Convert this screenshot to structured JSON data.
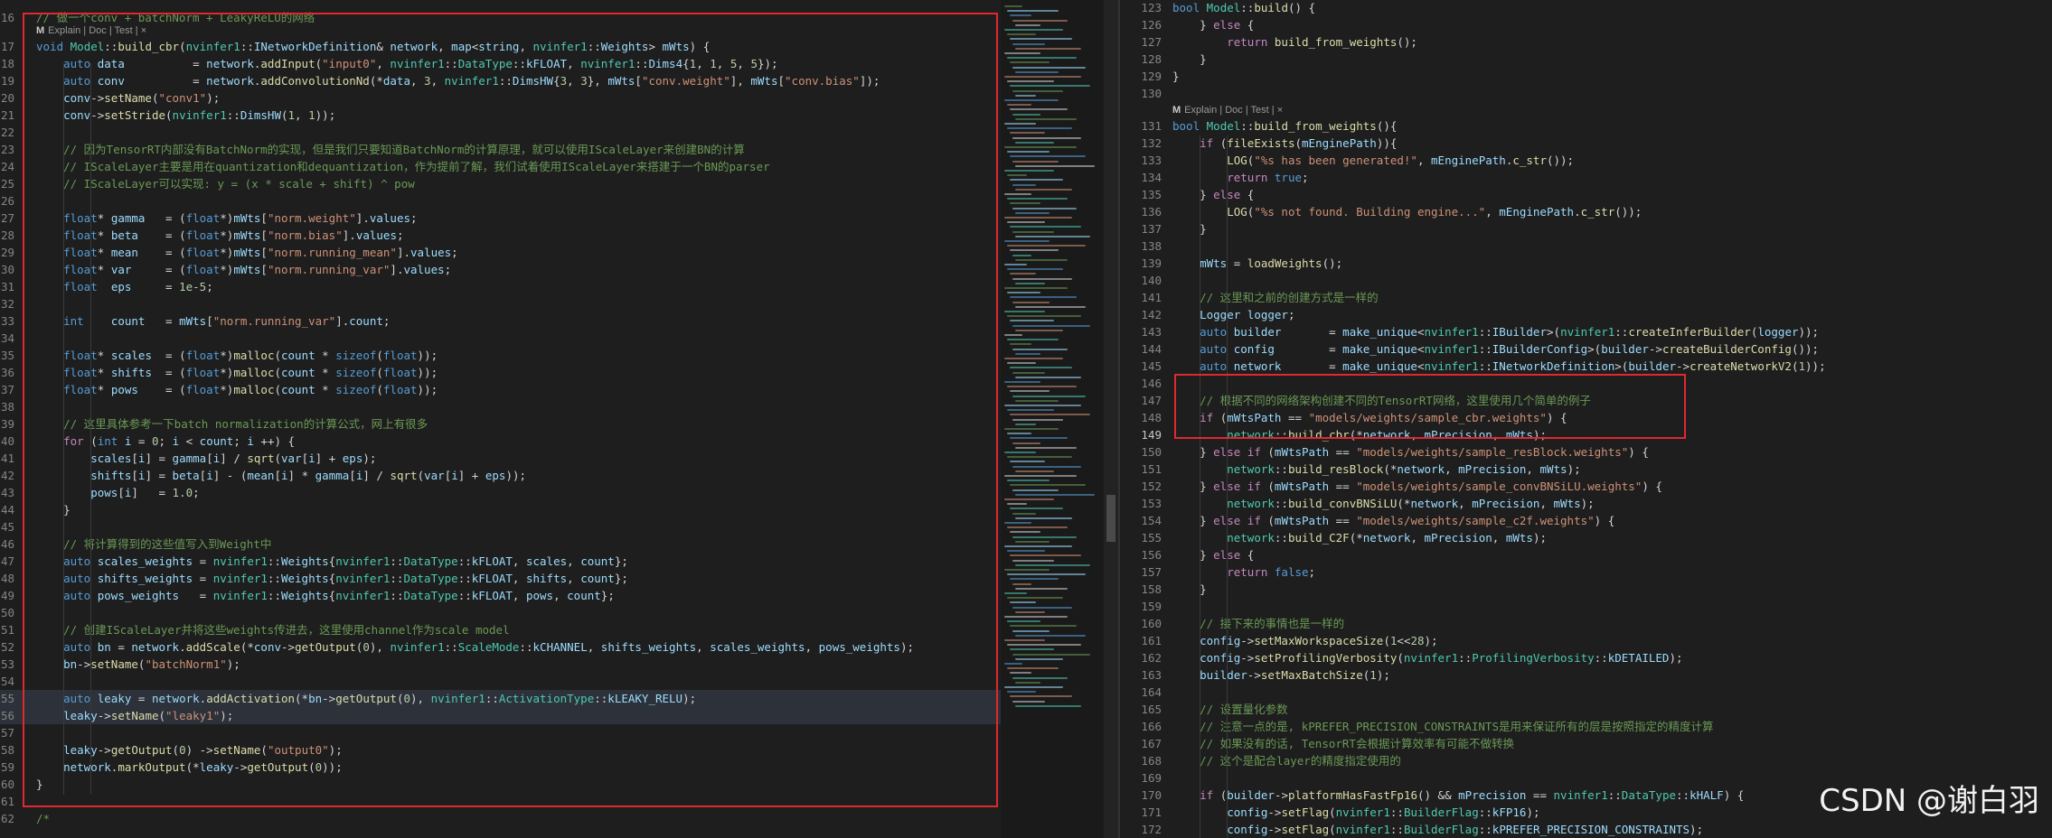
{
  "left_editor": {
    "codelens": "Explain | Doc | Test | ×",
    "lines": [
      {
        "n": "16",
        "t": "// 做一个conv + batchNorm + LeakyReLU的网络"
      },
      {
        "n": "17",
        "t": "void Model::build_cbr(nvinfer1::INetworkDefinition& network, map<string, nvinfer1::Weights> mWts) {"
      },
      {
        "n": "18",
        "t": "    auto data          = network.addInput(\"input0\", nvinfer1::DataType::kFLOAT, nvinfer1::Dims4{1, 1, 5, 5});"
      },
      {
        "n": "19",
        "t": "    auto conv          = network.addConvolutionNd(*data, 3, nvinfer1::DimsHW{3, 3}, mWts[\"conv.weight\"], mWts[\"conv.bias\"]);"
      },
      {
        "n": "20",
        "t": "    conv->setName(\"conv1\");"
      },
      {
        "n": "21",
        "t": "    conv->setStride(nvinfer1::DimsHW(1, 1));"
      },
      {
        "n": "22",
        "t": ""
      },
      {
        "n": "23",
        "t": "    // 因为TensorRT内部没有BatchNorm的实现，但是我们只要知道BatchNorm的计算原理，就可以使用IScaleLayer来创建BN的计算"
      },
      {
        "n": "24",
        "t": "    // IScaleLayer主要是用在quantization和dequantization，作为提前了解，我们试着使用IScaleLayer来搭建于一个BN的parser"
      },
      {
        "n": "25",
        "t": "    // IScaleLayer可以实现: y = (x * scale + shift) ^ pow"
      },
      {
        "n": "26",
        "t": ""
      },
      {
        "n": "27",
        "t": "    float* gamma   = (float*)mWts[\"norm.weight\"].values;"
      },
      {
        "n": "28",
        "t": "    float* beta    = (float*)mWts[\"norm.bias\"].values;"
      },
      {
        "n": "29",
        "t": "    float* mean    = (float*)mWts[\"norm.running_mean\"].values;"
      },
      {
        "n": "30",
        "t": "    float* var     = (float*)mWts[\"norm.running_var\"].values;"
      },
      {
        "n": "31",
        "t": "    float  eps     = 1e-5;"
      },
      {
        "n": "32",
        "t": ""
      },
      {
        "n": "33",
        "t": "    int    count   = mWts[\"norm.running_var\"].count;"
      },
      {
        "n": "34",
        "t": ""
      },
      {
        "n": "35",
        "t": "    float* scales  = (float*)malloc(count * sizeof(float));"
      },
      {
        "n": "36",
        "t": "    float* shifts  = (float*)malloc(count * sizeof(float));"
      },
      {
        "n": "37",
        "t": "    float* pows    = (float*)malloc(count * sizeof(float));"
      },
      {
        "n": "38",
        "t": ""
      },
      {
        "n": "39",
        "t": "    // 这里具体参考一下batch normalization的计算公式，网上有很多"
      },
      {
        "n": "40",
        "t": "    for (int i = 0; i < count; i ++) {"
      },
      {
        "n": "41",
        "t": "        scales[i] = gamma[i] / sqrt(var[i] + eps);"
      },
      {
        "n": "42",
        "t": "        shifts[i] = beta[i] - (mean[i] * gamma[i] / sqrt(var[i] + eps));"
      },
      {
        "n": "43",
        "t": "        pows[i]   = 1.0;"
      },
      {
        "n": "44",
        "t": "    }"
      },
      {
        "n": "45",
        "t": ""
      },
      {
        "n": "46",
        "t": "    // 将计算得到的这些值写入到Weight中"
      },
      {
        "n": "47",
        "t": "    auto scales_weights = nvinfer1::Weights{nvinfer1::DataType::kFLOAT, scales, count};"
      },
      {
        "n": "48",
        "t": "    auto shifts_weights = nvinfer1::Weights{nvinfer1::DataType::kFLOAT, shifts, count};"
      },
      {
        "n": "49",
        "t": "    auto pows_weights   = nvinfer1::Weights{nvinfer1::DataType::kFLOAT, pows, count};"
      },
      {
        "n": "50",
        "t": ""
      },
      {
        "n": "51",
        "t": "    // 创建IScaleLayer并将这些weights传进去，这里使用channel作为scale model"
      },
      {
        "n": "52",
        "t": "    auto bn = network.addScale(*conv->getOutput(0), nvinfer1::ScaleMode::kCHANNEL, shifts_weights, scales_weights, pows_weights);"
      },
      {
        "n": "53",
        "t": "    bn->setName(\"batchNorm1\");"
      },
      {
        "n": "54",
        "t": ""
      },
      {
        "n": "55",
        "t": "    auto leaky = network.addActivation(*bn->getOutput(0), nvinfer1::ActivationType::kLEAKY_RELU);"
      },
      {
        "n": "56",
        "t": "    leaky->setName(\"leaky1\");"
      },
      {
        "n": "57",
        "t": ""
      },
      {
        "n": "58",
        "t": "    leaky->getOutput(0) ->setName(\"output0\");"
      },
      {
        "n": "59",
        "t": "    network.markOutput(*leaky->getOutput(0));"
      },
      {
        "n": "60",
        "t": "}"
      },
      {
        "n": "61",
        "t": ""
      },
      {
        "n": "62",
        "t": "/*"
      }
    ]
  },
  "right_editor": {
    "codelens": "Explain | Doc | Test | ×",
    "lines": [
      {
        "n": "123",
        "t": "bool Model::build() {"
      },
      {
        "n": "126",
        "t": "    } else {"
      },
      {
        "n": "127",
        "t": "        return build_from_weights();"
      },
      {
        "n": "128",
        "t": "    }"
      },
      {
        "n": "129",
        "t": "}"
      },
      {
        "n": "130",
        "t": ""
      },
      {
        "n": "131",
        "t": "bool Model::build_from_weights(){"
      },
      {
        "n": "132",
        "t": "    if (fileExists(mEnginePath)){"
      },
      {
        "n": "133",
        "t": "        LOG(\"%s has been generated!\", mEnginePath.c_str());"
      },
      {
        "n": "134",
        "t": "        return true;"
      },
      {
        "n": "135",
        "t": "    } else {"
      },
      {
        "n": "136",
        "t": "        LOG(\"%s not found. Building engine...\", mEnginePath.c_str());"
      },
      {
        "n": "137",
        "t": "    }"
      },
      {
        "n": "138",
        "t": ""
      },
      {
        "n": "139",
        "t": "    mWts = loadWeights();"
      },
      {
        "n": "140",
        "t": ""
      },
      {
        "n": "141",
        "t": "    // 这里和之前的创建方式是一样的"
      },
      {
        "n": "142",
        "t": "    Logger logger;"
      },
      {
        "n": "143",
        "t": "    auto builder       = make_unique<nvinfer1::IBuilder>(nvinfer1::createInferBuilder(logger));"
      },
      {
        "n": "144",
        "t": "    auto config        = make_unique<nvinfer1::IBuilderConfig>(builder->createBuilderConfig());"
      },
      {
        "n": "145",
        "t": "    auto network       = make_unique<nvinfer1::INetworkDefinition>(builder->createNetworkV2(1));"
      },
      {
        "n": "146",
        "t": ""
      },
      {
        "n": "147",
        "t": "    // 根据不同的网络架构创建不同的TensorRT网络，这里使用几个简单的例子"
      },
      {
        "n": "148",
        "t": "    if (mWtsPath == \"models/weights/sample_cbr.weights\") {"
      },
      {
        "n": "149",
        "t": "        network::build_cbr(*network, mPrecision, mWts);"
      },
      {
        "n": "150",
        "t": "    } else if (mWtsPath == \"models/weights/sample_resBlock.weights\") {"
      },
      {
        "n": "151",
        "t": "        network::build_resBlock(*network, mPrecision, mWts);"
      },
      {
        "n": "152",
        "t": "    } else if (mWtsPath == \"models/weights/sample_convBNSiLU.weights\") {"
      },
      {
        "n": "153",
        "t": "        network::build_convBNSiLU(*network, mPrecision, mWts);"
      },
      {
        "n": "154",
        "t": "    } else if (mWtsPath == \"models/weights/sample_c2f.weights\") {"
      },
      {
        "n": "155",
        "t": "        network::build_C2F(*network, mPrecision, mWts);"
      },
      {
        "n": "156",
        "t": "    } else {"
      },
      {
        "n": "157",
        "t": "        return false;"
      },
      {
        "n": "158",
        "t": "    }"
      },
      {
        "n": "159",
        "t": ""
      },
      {
        "n": "160",
        "t": "    // 接下来的事情也是一样的"
      },
      {
        "n": "161",
        "t": "    config->setMaxWorkspaceSize(1<<28);"
      },
      {
        "n": "162",
        "t": "    config->setProfilingVerbosity(nvinfer1::ProfilingVerbosity::kDETAILED);"
      },
      {
        "n": "163",
        "t": "    builder->setMaxBatchSize(1);"
      },
      {
        "n": "164",
        "t": ""
      },
      {
        "n": "165",
        "t": "    // 设置量化参数"
      },
      {
        "n": "166",
        "t": "    // 注意一点的是, kPREFER_PRECISION_CONSTRAINTS是用来保证所有的层是按照指定的精度计算"
      },
      {
        "n": "167",
        "t": "    // 如果没有的话, TensorRT会根据计算效率有可能不做转换"
      },
      {
        "n": "168",
        "t": "    // 这个是配合layer的精度指定使用的"
      },
      {
        "n": "169",
        "t": ""
      },
      {
        "n": "170",
        "t": "    if (builder->platformHasFastFp16() && mPrecision == nvinfer1::DataType::kHALF) {"
      },
      {
        "n": "171",
        "t": "        config->setFlag(nvinfer1::BuilderFlag::kFP16);"
      },
      {
        "n": "172",
        "t": "        config->setFlag(nvinfer1::BuilderFlag::kPREFER_PRECISION_CONSTRAINTS);"
      }
    ]
  },
  "watermark": "CSDN @谢白羽",
  "colors": {
    "highlight_box": "#e0282f",
    "background": "#1e1e1e"
  }
}
